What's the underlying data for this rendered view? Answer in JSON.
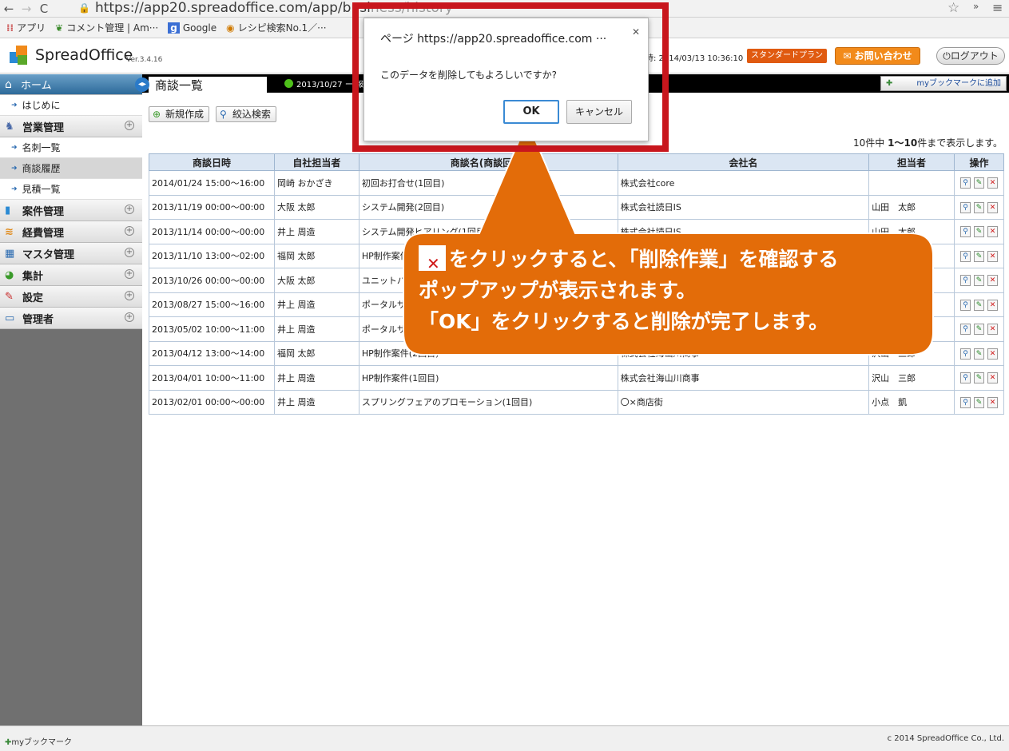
{
  "browser": {
    "url_main": "https://app20.spreadoffice.com/app/busi",
    "url_tail": "ness/history",
    "bookmarks": [
      "アプリ",
      "コメント管理 | Am···",
      "Google",
      "レシピ検索No.1／···"
    ]
  },
  "header": {
    "logo_text": "SpreadOffice",
    "version": "Ver.3.4.16",
    "time_label": "時: 2014/03/13 10:36:10",
    "plan_badge": "スタンダードプラン",
    "contact_label": "お問い合わせ",
    "logout_label": "ログアウト"
  },
  "sidebar": {
    "home": "ホーム",
    "hajimeni": "はじめに",
    "cat_sales": "営業管理",
    "sub_cards": "名刺一覧",
    "sub_history": "商談履歴",
    "sub_estimates": "見積一覧",
    "cat_projects": "案件管理",
    "cat_expenses": "経費管理",
    "cat_master": "マスタ管理",
    "cat_stats": "集計",
    "cat_settings": "設定",
    "cat_admin": "管理者"
  },
  "main": {
    "tab_title": "商談一覧",
    "tab_date": "2013/10/27 ー 報",
    "bookmark_add": "myブックマークに追加",
    "btn_new": "新規作成",
    "btn_search": "絞込検索",
    "count": {
      "pre": "10件中 ",
      "range": "1～10",
      "post": "件まで表示します。"
    }
  },
  "table": {
    "headers": [
      "商談日時",
      "自社担当者",
      "商談名(商談回数)",
      "会社名",
      "担当者",
      "操作"
    ],
    "rows": [
      [
        "2014/01/24 15:00～16:00",
        "岡崎 おかざき",
        "初回お打合せ(1回目)",
        "株式会社core",
        ""
      ],
      [
        "2013/11/19 00:00～00:00",
        "大阪 太郎",
        "システム開発(2回目)",
        "株式会社読日IS",
        "山田　太郎"
      ],
      [
        "2013/11/14 00:00～00:00",
        "井上 周造",
        "システム開発ヒアリング(1回目)",
        "株式会社読日IS",
        "山田　太郎"
      ],
      [
        "2013/11/10 13:00～02:00",
        "福岡 太郎",
        "HP制作案件",
        "",
        ""
      ],
      [
        "2013/10/26 00:00～00:00",
        "大阪 太郎",
        "ユニットバス",
        "",
        ""
      ],
      [
        "2013/08/27 15:00～16:00",
        "井上 周造",
        "ポータルサ",
        "",
        ""
      ],
      [
        "2013/05/02 10:00～11:00",
        "井上 周造",
        "ポータルサ",
        "",
        ""
      ],
      [
        "2013/04/12 13:00～14:00",
        "福岡 太郎",
        "HP制作案件(2回目)",
        "株式会社海山川商事",
        "沢山　三郎"
      ],
      [
        "2013/04/01 10:00～11:00",
        "井上 周造",
        "HP制作案件(1回目)",
        "株式会社海山川商事",
        "沢山　三郎"
      ],
      [
        "2013/02/01 00:00～00:00",
        "井上 周造",
        "スプリングフェアのプロモーション(1回目)",
        "〇×商店街",
        "小点　凱"
      ]
    ]
  },
  "footer": {
    "bookmark": "myブックマーク",
    "copyright": "c 2014 SpreadOffice Co., Ltd."
  },
  "dialog": {
    "title": "ページ https://app20.spreadoffice.com ···",
    "message": "このデータを削除してもよろしいですか?",
    "ok": "OK",
    "cancel": "キャンセル"
  },
  "callout": {
    "line1": "をクリックすると､「削除作業」を確認する",
    "line2": "ポップアップが表示されます。",
    "line3": "「OK」をクリックすると削除が完了します。"
  },
  "colors": {
    "callout": "#e36c09",
    "frame": "#c8161d"
  }
}
